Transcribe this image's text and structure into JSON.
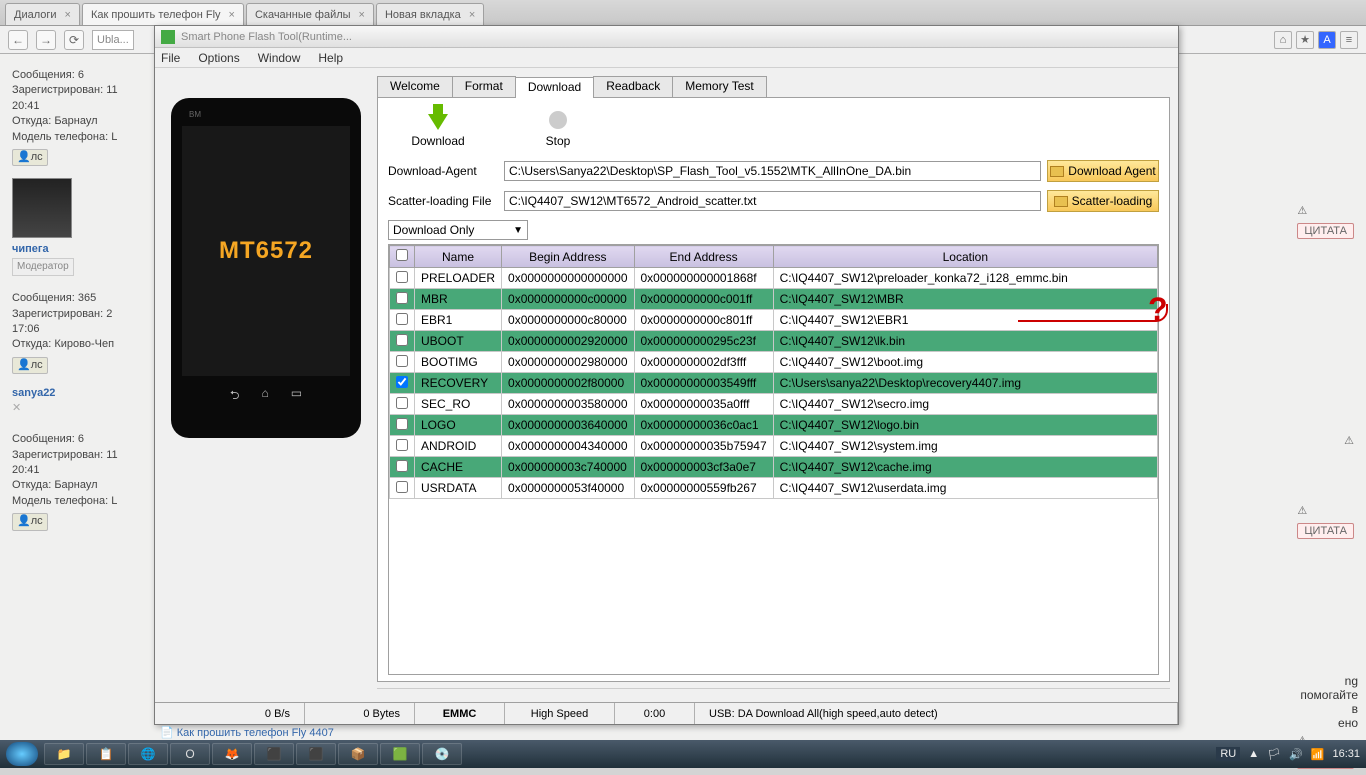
{
  "browser": {
    "tabs": [
      {
        "label": "Диалоги"
      },
      {
        "label": "Как прошить телефон Fly"
      },
      {
        "label": "Скачанные файлы"
      },
      {
        "label": "Новая вкладка"
      }
    ],
    "address": "Ubla..."
  },
  "forum": {
    "user1": {
      "msgs_label": "Сообщения:",
      "msgs": "6",
      "reg_label": "Зарегистрирован:",
      "reg": "11",
      "time": "20:41",
      "from_label": "Откуда:",
      "from": "Барнаул",
      "model_label": "Модель телефона:",
      "model": "L",
      "ls": "лс"
    },
    "user2": {
      "name": "чипега",
      "role": "Модератор",
      "msgs_label": "Сообщения:",
      "msgs": "365",
      "reg_label": "Зарегистрирован:",
      "reg": "2",
      "time": "17:06",
      "from_label": "Откуда:",
      "from": "Кирово-Чеп",
      "ls": "лс"
    },
    "user3": {
      "name": "sanya22",
      "msgs_label": "Сообщения:",
      "msgs": "6",
      "reg_label": "Зарегистрирован:",
      "reg": "11",
      "time": "20:41",
      "from_label": "Откуда:",
      "from": "Барнаул",
      "model_label": "Модель телефона:",
      "model": "L",
      "ls": "лс"
    },
    "quote_btn": "ЦИТАТА",
    "help_text": "ng помогайте в",
    "link_bottom": "Как прошить телефон Fly 4407"
  },
  "app": {
    "title": "Smart Phone Flash Tool(Runtime...",
    "menu": {
      "file": "File",
      "options": "Options",
      "window": "Window",
      "help": "Help"
    },
    "tabs": {
      "welcome": "Welcome",
      "format": "Format",
      "download": "Download",
      "readback": "Readback",
      "memtest": "Memory Test"
    },
    "toolbar": {
      "download": "Download",
      "stop": "Stop"
    },
    "da_label": "Download-Agent",
    "da_value": "C:\\Users\\Sanya22\\Desktop\\SP_Flash_Tool_v5.1552\\MTK_AllInOne_DA.bin",
    "da_btn": "Download Agent",
    "scatter_label": "Scatter-loading File",
    "scatter_value": "C:\\IQ4407_SW12\\MT6572_Android_scatter.txt",
    "scatter_btn": "Scatter-loading",
    "combo": "Download Only",
    "phone_chip": "MT6572",
    "phone_brand": "BM",
    "headers": {
      "name": "Name",
      "begin": "Begin Address",
      "end": "End Address",
      "loc": "Location"
    },
    "rows": [
      {
        "chk": false,
        "hl": false,
        "name": "PRELOADER",
        "begin": "0x0000000000000000",
        "end": "0x000000000001868f",
        "loc": "C:\\IQ4407_SW12\\preloader_konka72_i128_emmc.bin"
      },
      {
        "chk": false,
        "hl": true,
        "name": "MBR",
        "begin": "0x0000000000c00000",
        "end": "0x0000000000c001ff",
        "loc": "C:\\IQ4407_SW12\\MBR"
      },
      {
        "chk": false,
        "hl": false,
        "name": "EBR1",
        "begin": "0x0000000000c80000",
        "end": "0x0000000000c801ff",
        "loc": "C:\\IQ4407_SW12\\EBR1"
      },
      {
        "chk": false,
        "hl": true,
        "name": "UBOOT",
        "begin": "0x0000000002920000",
        "end": "0x000000000295c23f",
        "loc": "C:\\IQ4407_SW12\\lk.bin"
      },
      {
        "chk": false,
        "hl": false,
        "name": "BOOTIMG",
        "begin": "0x0000000002980000",
        "end": "0x0000000002df3fff",
        "loc": "C:\\IQ4407_SW12\\boot.img"
      },
      {
        "chk": true,
        "hl": true,
        "name": "RECOVERY",
        "begin": "0x0000000002f80000",
        "end": "0x00000000003549fff",
        "loc": "C:\\Users\\sanya22\\Desktop\\recovery4407.img"
      },
      {
        "chk": false,
        "hl": false,
        "name": "SEC_RO",
        "begin": "0x0000000003580000",
        "end": "0x00000000035a0fff",
        "loc": "C:\\IQ4407_SW12\\secro.img"
      },
      {
        "chk": false,
        "hl": true,
        "name": "LOGO",
        "begin": "0x0000000003640000",
        "end": "0x00000000036c0ac1",
        "loc": "C:\\IQ4407_SW12\\logo.bin"
      },
      {
        "chk": false,
        "hl": false,
        "name": "ANDROID",
        "begin": "0x0000000004340000",
        "end": "0x00000000035b75947",
        "loc": "C:\\IQ4407_SW12\\system.img"
      },
      {
        "chk": false,
        "hl": true,
        "name": "CACHE",
        "begin": "0x000000003c740000",
        "end": "0x000000003cf3a0e7",
        "loc": "C:\\IQ4407_SW12\\cache.img"
      },
      {
        "chk": false,
        "hl": false,
        "name": "USRDATA",
        "begin": "0x0000000053f40000",
        "end": "0x00000000559fb267",
        "loc": "C:\\IQ4407_SW12\\userdata.img"
      }
    ],
    "status": {
      "bps": "0 B/s",
      "bytes": "0 Bytes",
      "emmc": "EMMC",
      "speed": "High Speed",
      "time": "0:00",
      "usb": "USB: DA Download All(high speed,auto detect)"
    }
  },
  "taskbar": {
    "lang": "RU",
    "clock": "16:31"
  }
}
